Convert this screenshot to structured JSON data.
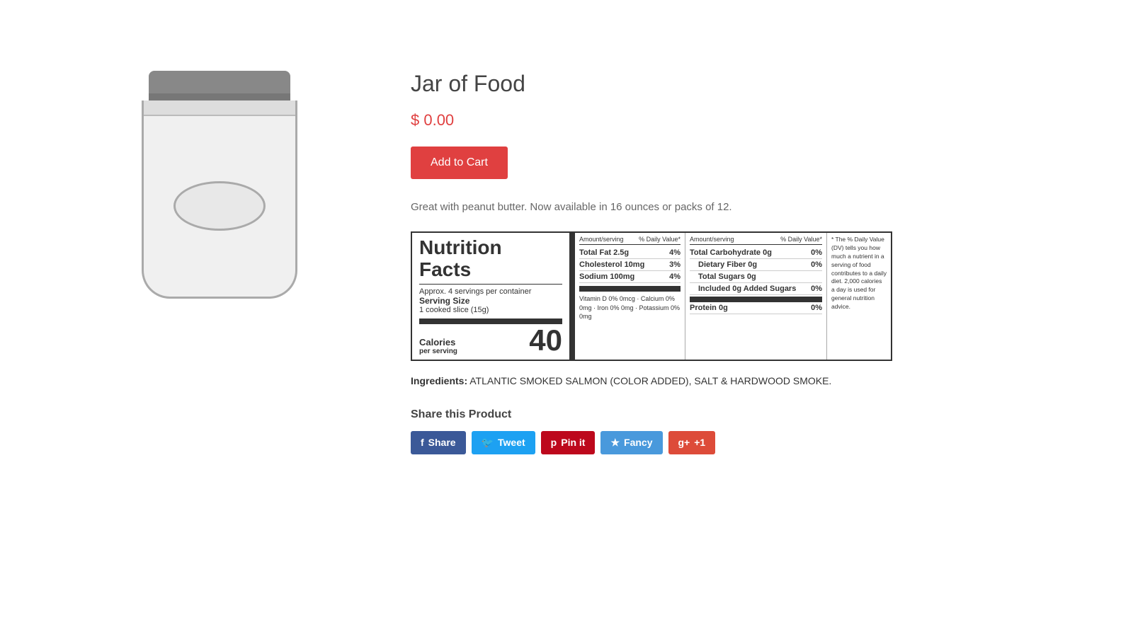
{
  "product": {
    "title": "Jar of Food",
    "price": "$ 0.00",
    "add_to_cart_label": "Add to Cart",
    "description": "Great with peanut butter. Now available in 16 ounces or packs of 12.",
    "ingredients_label": "Ingredients:",
    "ingredients_value": "ATLANTIC SMOKED SALMON (COLOR ADDED), SALT & HARDWOOD SMOKE."
  },
  "nutrition": {
    "title_line1": "Nutrition",
    "title_line2": "Facts",
    "servings_per_container": "Approx. 4 servings per container",
    "serving_size_label": "Serving Size",
    "serving_size_value": "1 cooked slice (15g)",
    "calories_label": "Calories",
    "calories_per_serving_label": "per serving",
    "calories_value": "40",
    "amount_per_serving": "Amount/serving",
    "pct_daily_value": "% Daily Value*",
    "rows_left": [
      {
        "label": "Total Fat 2.5g",
        "pct": "4%"
      },
      {
        "label": "Cholesterol 10mg",
        "pct": "3%"
      },
      {
        "label": "Sodium 100mg",
        "pct": "4%"
      }
    ],
    "rows_right": [
      {
        "label": "Total Carbohydrate 0g",
        "pct": "0%",
        "indent": false
      },
      {
        "label": "Dietary Fiber 0g",
        "pct": "0%",
        "indent": true
      },
      {
        "label": "Total Sugars 0g",
        "pct": "",
        "indent": true
      },
      {
        "label": "Included 0g Added Sugars",
        "pct": "0%",
        "indent": true
      },
      {
        "label": "Protein 0g",
        "pct": "0%",
        "indent": false,
        "thick_top": true
      }
    ],
    "vitamins": "Vitamin D 0% 0mcg  ·  Calcium 0% 0mg  ·  Iron 0% 0mg  ·  Potassium 0% 0mg",
    "footnote": "* The % Daily Value (DV) tells you how much a nutrient in a serving of food contributes to a daily diet. 2,000 calories a day is used for general nutrition advice."
  },
  "share": {
    "title": "Share this Product",
    "buttons": [
      {
        "label": "Share",
        "icon": "f",
        "platform": "facebook"
      },
      {
        "label": "Tweet",
        "icon": "t",
        "platform": "twitter"
      },
      {
        "label": "Pin it",
        "icon": "p",
        "platform": "pinterest"
      },
      {
        "label": "Fancy",
        "icon": "★",
        "platform": "fancy"
      },
      {
        "label": "+1",
        "icon": "g+",
        "platform": "googleplus"
      }
    ]
  }
}
